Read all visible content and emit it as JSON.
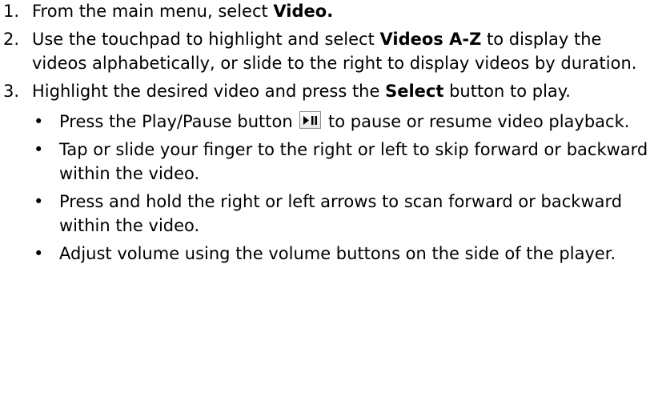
{
  "steps": [
    {
      "num": "1.",
      "pre": "From the main menu, select ",
      "bold": "Video.",
      "post": ""
    },
    {
      "num": "2.",
      "pre": "Use the touchpad to highlight and select ",
      "bold": "Videos A-Z",
      "post": " to display the videos alphabetically, or slide to the right to display videos by duration."
    },
    {
      "num": "3.",
      "pre": "Highlight the desired video and press the ",
      "bold": "Select",
      "post": " button to play."
    }
  ],
  "bullets": [
    {
      "bullet": "•",
      "pre": "Press the Play/Pause button ",
      "icon": "play-pause-icon",
      "post": " to pause or resume video playback."
    },
    {
      "bullet": "•",
      "text": "Tap or slide your finger to the right or left to skip forward or backward within the video."
    },
    {
      "bullet": "•",
      "text": "Press and hold the right or left arrows to scan forward or backward within the video."
    },
    {
      "bullet": "•",
      "text": "Adjust volume using the volume buttons on the side of the player."
    }
  ]
}
